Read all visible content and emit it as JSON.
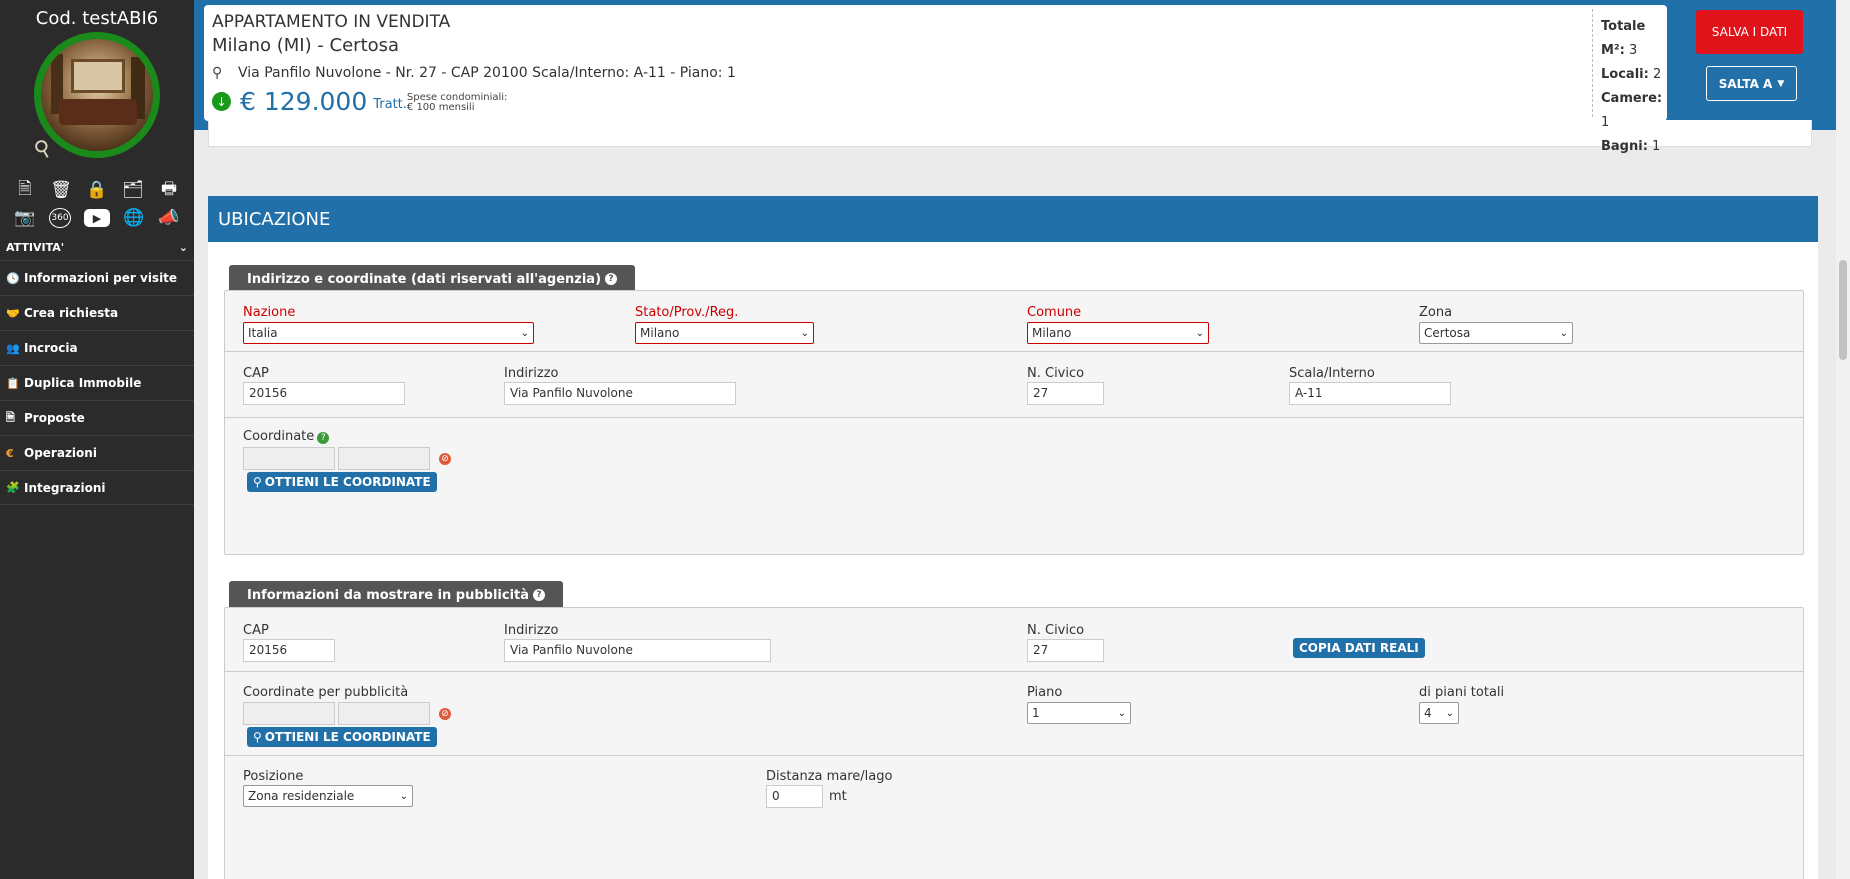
{
  "sidebar": {
    "code": "Cod. testABI6",
    "icons_row1": [
      "file-icon",
      "trash-icon",
      "lock-icon",
      "folder-open-icon",
      "print-icon"
    ],
    "icons_row2": [
      "camera-icon",
      "360-icon",
      "youtube-icon",
      "globe-icon",
      "megaphone-icon"
    ],
    "section_title": "ATTIVITA'",
    "items": [
      {
        "label": "Informazioni per visite",
        "icon": "clock-icon"
      },
      {
        "label": "Crea richiesta",
        "icon": "handshake-icon"
      },
      {
        "label": "Incrocia",
        "icon": "users-icon"
      },
      {
        "label": "Duplica Immobile",
        "icon": "copy-icon"
      },
      {
        "label": "Proposte",
        "icon": "document-icon"
      },
      {
        "label": "Operazioni",
        "icon": "euro-icon"
      },
      {
        "label": "Integrazioni",
        "icon": "puzzle-icon"
      }
    ]
  },
  "header": {
    "title": "APPARTAMENTO IN VENDITA",
    "location": "Milano (MI) - Certosa",
    "address": "Via Panfilo Nuvolone - Nr. 27 - CAP 20100  Scala/Interno: A-11 - Piano: 1",
    "price": "€ 129.000",
    "tratt": "Tratt.",
    "spese_label": "Spese condominiali:",
    "spese_value": "€ 100 mensili",
    "stats": {
      "totale_label": "Totale M²:",
      "totale_value": "3",
      "locali_label": "Locali:",
      "locali_value": "2",
      "camere_label": "Camere:",
      "camere_value": "1",
      "bagni_label": "Bagni:",
      "bagni_value": "1"
    },
    "salva_label": "SALVA I DATI",
    "salta_label": "SALTA A"
  },
  "colors": {
    "brand_blue": "#2270a9",
    "save_red": "#e0121a",
    "required_red": "#cc0000",
    "badge_green": "#1a8a1a"
  },
  "panel": {
    "title": "UBICAZIONE",
    "section1": {
      "title": "Indirizzo e coordinate (dati riservati all'agenzia)",
      "nazione_label": "Nazione",
      "nazione_value": "Italia",
      "stato_label": "Stato/Prov./Reg.",
      "stato_value": "Milano",
      "comune_label": "Comune",
      "comune_value": "Milano",
      "zona_label": "Zona",
      "zona_value": "Certosa",
      "cap_label": "CAP",
      "cap_value": "20156",
      "indirizzo_label": "Indirizzo",
      "indirizzo_value": "Via Panfilo Nuvolone",
      "civico_label": "N. Civico",
      "civico_value": "27",
      "scala_label": "Scala/Interno",
      "scala_value": "A-11",
      "coord_label": "Coordinate",
      "coord_button": "OTTIENI LE COORDINATE"
    },
    "section2": {
      "title": "Informazioni da mostrare in pubblicità",
      "cap_label": "CAP",
      "cap_value": "20156",
      "indirizzo_label": "Indirizzo",
      "indirizzo_value": "Via Panfilo Nuvolone",
      "civico_label": "N. Civico",
      "civico_value": "27",
      "copia_button": "COPIA DATI REALI",
      "coord_label": "Coordinate per pubblicità",
      "coord_button": "OTTIENI LE COORDINATE",
      "piano_label": "Piano",
      "piano_value": "1",
      "piani_totali_label": "di piani totali",
      "piani_totali_value": "4",
      "posizione_label": "Posizione",
      "posizione_value": "Zona residenziale",
      "distanza_label": "Distanza mare/lago",
      "distanza_value": "0",
      "distanza_unit": "mt"
    }
  }
}
